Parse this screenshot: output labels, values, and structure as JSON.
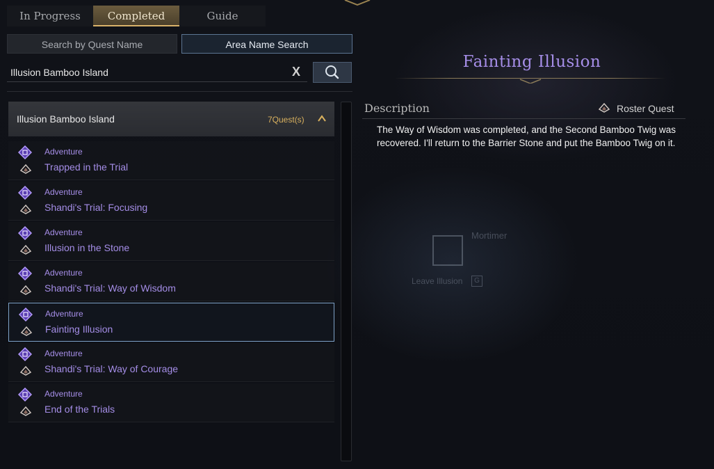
{
  "tabs": [
    "In Progress",
    "Completed",
    "Guide"
  ],
  "active_tab": "Completed",
  "search_type": {
    "by_quest_name": "Search by Quest Name",
    "by_area_name": "Area Name Search"
  },
  "search": {
    "value": "Illusion Bamboo Island",
    "clear": "X"
  },
  "group": {
    "name": "Illusion Bamboo Island",
    "count": "7Quest(s)"
  },
  "quests": [
    {
      "category": "Adventure",
      "name": "Trapped in the Trial"
    },
    {
      "category": "Adventure",
      "name": "Shandi's Trial: Focusing"
    },
    {
      "category": "Adventure",
      "name": "Illusion in the Stone"
    },
    {
      "category": "Adventure",
      "name": "Shandi's Trial: Way of Wisdom"
    },
    {
      "category": "Adventure",
      "name": "Fainting Illusion"
    },
    {
      "category": "Adventure",
      "name": "Shandi's Trial: Way of Courage"
    },
    {
      "category": "Adventure",
      "name": "End of the Trials"
    }
  ],
  "selected_index": 4,
  "detail": {
    "title": "Fainting Illusion",
    "description_label": "Description",
    "quest_type": "Roster Quest",
    "description": "The Way of Wisdom was completed, and the Second Bamboo Twig was recovered. I'll return to the Barrier Stone and put the Bamboo Twig on it."
  },
  "world": {
    "npc_name": "Mortimer",
    "leave_label": "Leave Illusion",
    "leave_key": "G"
  },
  "colors": {
    "accent_purple": "#a68ee8",
    "gold": "#d9b15e",
    "selection": "#7ea2c8"
  }
}
